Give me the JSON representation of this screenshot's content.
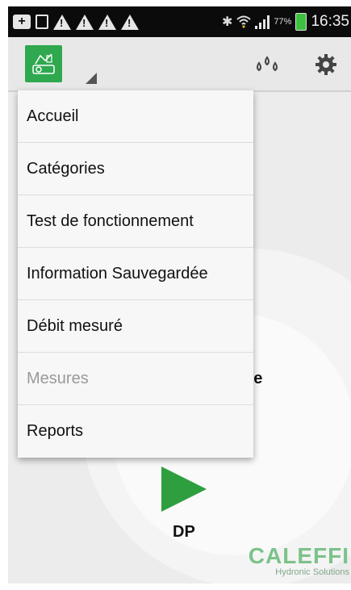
{
  "status_bar": {
    "battery_percent": "77%",
    "time": "16:35"
  },
  "action_bar": {
    "app_icon": "caleffi-app-icon",
    "drops_icon": "drops-icon",
    "settings_icon": "gear-icon"
  },
  "menu": {
    "items": [
      {
        "label": "Accueil",
        "enabled": true
      },
      {
        "label": "Catégories",
        "enabled": true
      },
      {
        "label": "Test de fonctionnement",
        "enabled": true
      },
      {
        "label": "Information Sauvegardée",
        "enabled": true
      },
      {
        "label": "Débit mesuré",
        "enabled": true
      },
      {
        "label": "Mesures",
        "enabled": false
      },
      {
        "label": "Reports",
        "enabled": true
      }
    ]
  },
  "background": {
    "partial_label": "ge",
    "play_label": "DP"
  },
  "brand": {
    "name": "CALEFFI",
    "tagline": "Hydronic Solutions"
  },
  "colors": {
    "accent": "#2fa84f",
    "play": "#2f9e3e",
    "status_bar": "#0b0b0b"
  }
}
